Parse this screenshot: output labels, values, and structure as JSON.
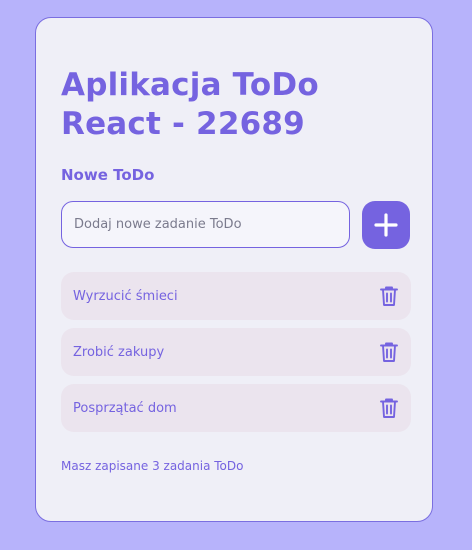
{
  "app": {
    "title": "Aplikacja ToDo React - 22689"
  },
  "new_todo": {
    "section_label": "Nowe ToDo",
    "input_value": "",
    "input_placeholder": "Dodaj nowe zadanie ToDo",
    "add_icon": "plus-icon"
  },
  "todos": [
    {
      "label": "Wyrzucić śmieci",
      "delete_icon": "trash-icon"
    },
    {
      "label": "Zrobić zakupy",
      "delete_icon": "trash-icon"
    },
    {
      "label": "Posprzątać dom",
      "delete_icon": "trash-icon"
    }
  ],
  "footer": {
    "summary": "Masz zapisane 3 zadania ToDo"
  },
  "colors": {
    "background": "#b7b3fb",
    "card": "#efeff7",
    "accent": "#7563e0",
    "item_background": "#ebe4ee"
  }
}
